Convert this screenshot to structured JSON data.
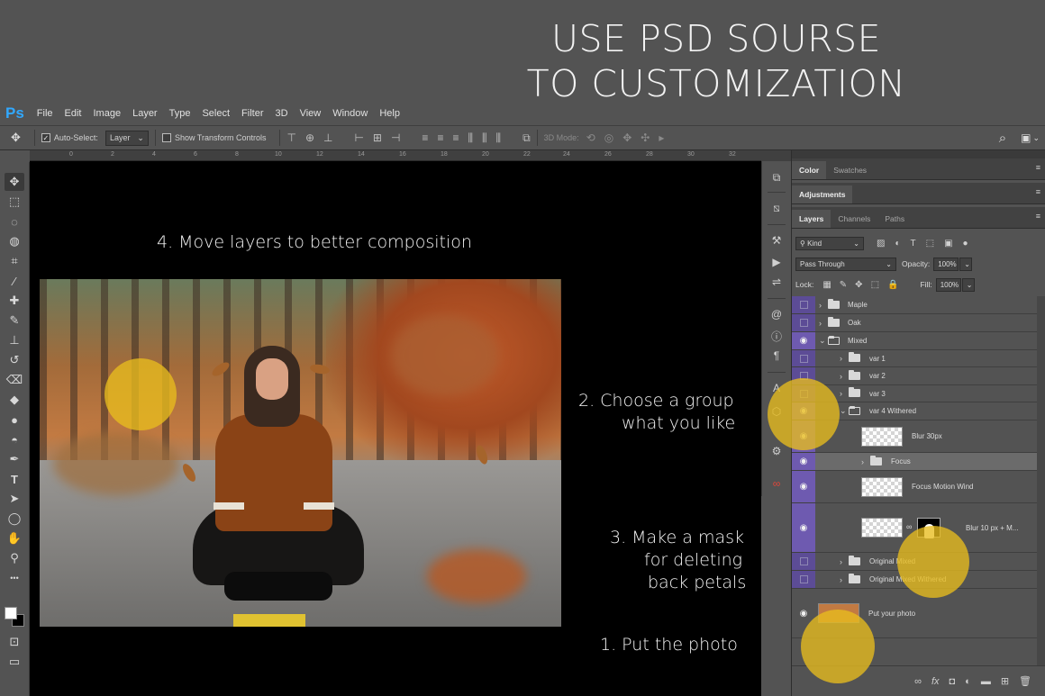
{
  "headline": {
    "line1": "USE PSD SOURSE",
    "line2": "TO CUSTOMIZATION"
  },
  "app": {
    "logo": "Ps",
    "menu": [
      "File",
      "Edit",
      "Image",
      "Layer",
      "Type",
      "Select",
      "Filter",
      "3D",
      "View",
      "Window",
      "Help"
    ]
  },
  "options": {
    "auto_select_label": "Auto-Select:",
    "auto_select_checked": "✓",
    "auto_select_value": "Layer",
    "show_transform_label": "Show Transform Controls",
    "mode_3d_label": "3D Mode:"
  },
  "ruler": [
    "0",
    "2",
    "4",
    "6",
    "8",
    "10",
    "12",
    "14",
    "16",
    "18",
    "20",
    "22",
    "24",
    "26",
    "28",
    "30",
    "32"
  ],
  "icons": {
    "move": "✥",
    "marquee": "⬚",
    "lasso": "◌",
    "quick_select": "◍",
    "crop": "⌗",
    "eyedropper": "⁄",
    "healing": "✚",
    "brush": "✎",
    "stamp": "⊥",
    "history": "↺",
    "eraser": "⌫",
    "bucket": "◆",
    "blur": "●",
    "dodge": "◓",
    "pen": "✒",
    "type": "T",
    "path_select": "➤",
    "shape": "◯",
    "hand": "✋",
    "zoom": "⚲",
    "more": "•••",
    "quickmask": "⊡",
    "screen": "▭",
    "search": "⌕",
    "workspace": "▣",
    "eye": "◉",
    "link": "∞",
    "chevron": "›",
    "chevron_open": "⌄",
    "menu": "≡"
  },
  "canvas": {
    "step4": "4. Move layers  to better composition",
    "step2_line1": "2. Choose a group",
    "step2_line2": "what you like",
    "step3_line1": "3. Make a mask",
    "step3_line2": "for deleting",
    "step3_line3": "back petals",
    "step1": "1. Put the photo"
  },
  "panels": {
    "top_tabs": [
      "Color",
      "Swatches"
    ],
    "adjustments_tab": "Adjustments",
    "layer_tabs": [
      "Layers",
      "Channels",
      "Paths"
    ],
    "filter_kind": "Kind",
    "blend_mode": "Pass Through",
    "opacity_label": "Opacity:",
    "opacity_value": "100%",
    "lock_label": "Lock:",
    "fill_label": "Fill:",
    "fill_value": "100%"
  },
  "layers": [
    {
      "name": "Maple",
      "visible": false,
      "type": "group"
    },
    {
      "name": "Oak",
      "visible": false,
      "type": "group"
    },
    {
      "name": "Mixed",
      "visible": true,
      "type": "group-open"
    },
    {
      "name": "var 1",
      "visible": false,
      "type": "group"
    },
    {
      "name": "var 2",
      "visible": false,
      "type": "group"
    },
    {
      "name": "var 3",
      "visible": false,
      "type": "group"
    },
    {
      "name": "var 4 Withered",
      "visible": true,
      "type": "group-open"
    },
    {
      "name": "Blur 30px",
      "visible": true,
      "type": "layer"
    },
    {
      "name": "Focus",
      "visible": true,
      "type": "group",
      "selected": true
    },
    {
      "name": "Focus Motion Wind",
      "visible": true,
      "type": "layer"
    },
    {
      "name": "Blur 10 px + M...",
      "visible": true,
      "type": "layer-mask"
    },
    {
      "name": "Original Mixed",
      "visible": false,
      "type": "group"
    },
    {
      "name": "Original Mixed Withered",
      "visible": false,
      "type": "group"
    },
    {
      "name": "Put your photo",
      "visible": true,
      "type": "photo"
    }
  ],
  "colors": {
    "highlight": "#e8bc1e",
    "layer_accent": "#6e5ab0",
    "ps_blue": "#31a8ff"
  }
}
